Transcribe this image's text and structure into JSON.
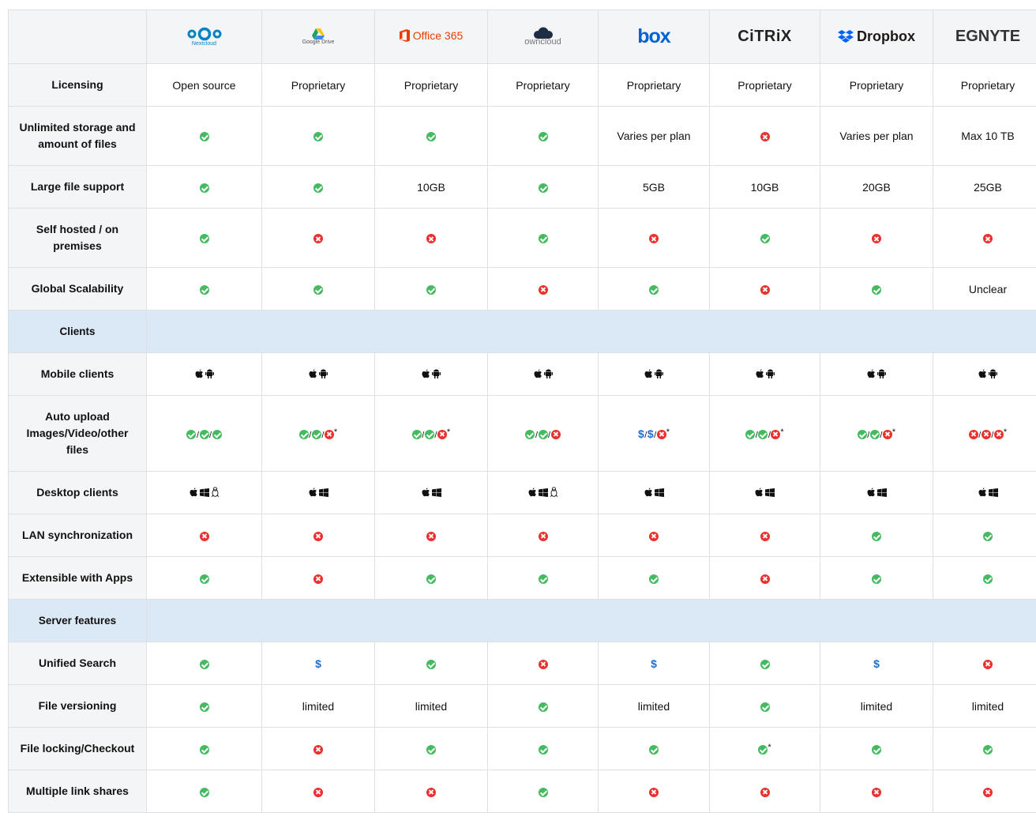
{
  "colors": {
    "ok": "#46ba61",
    "no": "#e9322d",
    "dollar": "#1a6fcf",
    "section_bg": "#dbe9f6",
    "header_bg": "#f4f5f6"
  },
  "vendors": [
    {
      "id": "nextcloud",
      "name": "Nextcloud",
      "logo_text": "Nextcloud"
    },
    {
      "id": "google-drive",
      "name": "Google Drive",
      "logo_text": "Google Drive"
    },
    {
      "id": "office365",
      "name": "Office 365",
      "logo_text": "Office 365"
    },
    {
      "id": "owncloud",
      "name": "ownCloud",
      "logo_text": "owncloud"
    },
    {
      "id": "box",
      "name": "box",
      "logo_text": "box"
    },
    {
      "id": "citrix",
      "name": "Citrix",
      "logo_text": "CiTRiX"
    },
    {
      "id": "dropbox",
      "name": "Dropbox",
      "logo_text": "Dropbox"
    },
    {
      "id": "egnyte",
      "name": "Egnyte",
      "logo_text": "EGNYTE"
    }
  ],
  "rows": [
    {
      "label": "Licensing",
      "cells": [
        "Open source",
        "Proprietary",
        "Proprietary",
        "Proprietary",
        "Proprietary",
        "Proprietary",
        "Proprietary",
        "Proprietary"
      ]
    },
    {
      "label": "Unlimited storage and amount of files",
      "cells": [
        "ok",
        "ok",
        "ok",
        "ok",
        "Varies per plan",
        "no",
        "Varies per plan",
        "Max 10 TB"
      ]
    },
    {
      "label": "Large file support",
      "cells": [
        "ok",
        "ok",
        "10GB",
        "ok",
        "5GB",
        "10GB",
        "20GB",
        "25GB"
      ]
    },
    {
      "label": "Self hosted / on premises",
      "cells": [
        "ok",
        "no",
        "no",
        "ok",
        "no",
        "ok",
        "no",
        "no"
      ]
    },
    {
      "label": "Global Scalability",
      "cells": [
        "ok",
        "ok",
        "ok",
        "no",
        "ok",
        "no",
        "ok",
        "Unclear"
      ]
    },
    {
      "section": "Clients"
    },
    {
      "label": "Mobile clients",
      "cells": [
        "platforms:apple,android",
        "platforms:apple,android",
        "platforms:apple,android",
        "platforms:apple,android",
        "platforms:apple,android",
        "platforms:apple,android",
        "platforms:apple,android",
        "platforms:apple,android"
      ]
    },
    {
      "label": "Auto upload Images/Video/other files",
      "cells": [
        "multi:ok,ok,ok",
        "multi:ok,ok,no,*",
        "multi:ok,ok,no,*",
        "multi:ok,ok,no",
        "multi:$,$,no,*",
        "multi:ok,ok,no,*",
        "multi:ok,ok,no,*",
        "multi:no,no,no,*"
      ]
    },
    {
      "label": "Desktop clients",
      "cells": [
        "platforms:apple,windows,linux",
        "platforms:apple,windows",
        "platforms:apple,windows",
        "platforms:apple,windows,linux",
        "platforms:apple,windows",
        "platforms:apple,windows",
        "platforms:apple,windows",
        "platforms:apple,windows"
      ]
    },
    {
      "label": "LAN synchronization",
      "cells": [
        "no",
        "no",
        "no",
        "no",
        "no",
        "no",
        "ok",
        "ok"
      ]
    },
    {
      "label": "Extensible with Apps",
      "cells": [
        "ok",
        "no",
        "ok",
        "ok",
        "ok",
        "no",
        "ok",
        "ok"
      ]
    },
    {
      "section": "Server features"
    },
    {
      "label": "Unified Search",
      "cells": [
        "ok",
        "$",
        "ok",
        "no",
        "$",
        "ok",
        "$",
        "no"
      ]
    },
    {
      "label": "File versioning",
      "cells": [
        "ok",
        "limited",
        "limited",
        "ok",
        "limited",
        "ok",
        "limited",
        "limited"
      ]
    },
    {
      "label": "File locking/Checkout",
      "cells": [
        "ok",
        "no",
        "ok",
        "ok",
        "ok",
        "ok*",
        "ok",
        "ok"
      ]
    },
    {
      "label": "Multiple link shares",
      "cells": [
        "ok",
        "no",
        "no",
        "ok",
        "no",
        "no",
        "no",
        "no"
      ]
    }
  ]
}
